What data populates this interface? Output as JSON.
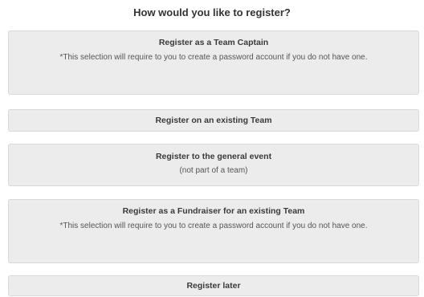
{
  "heading": "How would you like to register?",
  "options": [
    {
      "title": "Register as a Team Captain",
      "description": "*This selection will require to you to create a password account if you do not have one."
    },
    {
      "title": "Register on an existing Team"
    },
    {
      "title": "Register to the general event",
      "description": "(not part of a team)"
    },
    {
      "title": "Register as a Fundraiser for an existing Team",
      "description": "*This selection will require to you to create a password account if you do not have one."
    },
    {
      "title": "Register later"
    }
  ],
  "colors": {
    "option_background": "#ececec",
    "option_border": "#d9d9d9",
    "text": "#333333"
  }
}
